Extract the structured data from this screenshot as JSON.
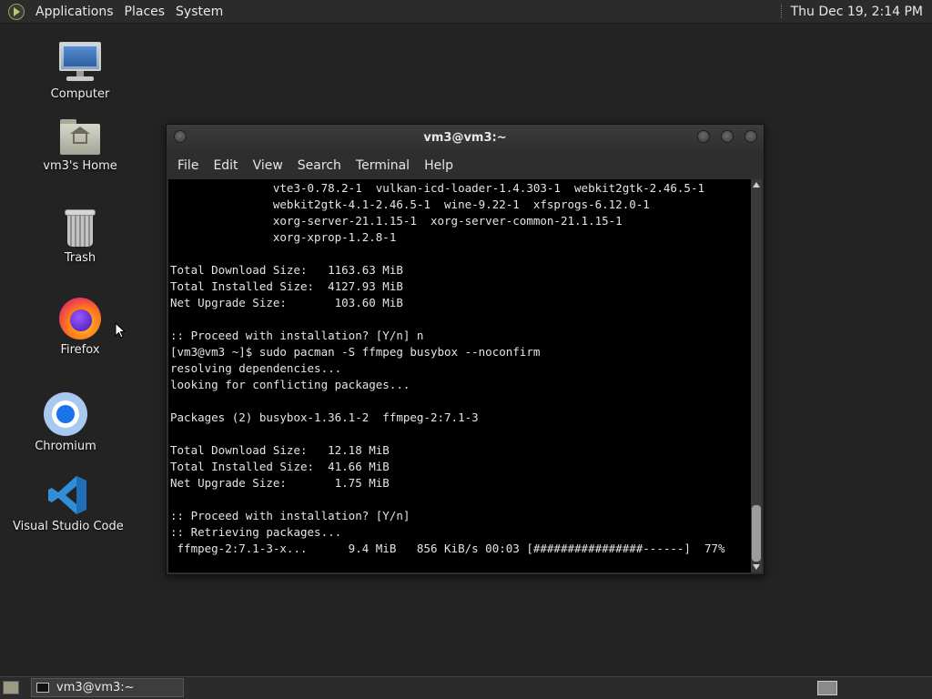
{
  "top_panel": {
    "menus": [
      "Applications",
      "Places",
      "System"
    ],
    "clock": "Thu Dec 19,  2:14 PM"
  },
  "desktop_icons": [
    {
      "label": "Computer",
      "icon": "computer-icon"
    },
    {
      "label": "vm3's Home",
      "icon": "home-folder-icon"
    },
    {
      "label": "Trash",
      "icon": "trash-icon"
    },
    {
      "label": "Firefox",
      "icon": "firefox-icon"
    },
    {
      "label": "Chromium",
      "icon": "chromium-icon"
    },
    {
      "label": "Visual Studio Code",
      "icon": "vscode-icon"
    }
  ],
  "terminal": {
    "title": "vm3@vm3:~",
    "menu": [
      "File",
      "Edit",
      "View",
      "Search",
      "Terminal",
      "Help"
    ],
    "lines": [
      "               vte3-0.78.2-1  vulkan-icd-loader-1.4.303-1  webkit2gtk-2.46.5-1",
      "               webkit2gtk-4.1-2.46.5-1  wine-9.22-1  xfsprogs-6.12.0-1",
      "               xorg-server-21.1.15-1  xorg-server-common-21.1.15-1",
      "               xorg-xprop-1.2.8-1",
      "",
      "Total Download Size:   1163.63 MiB",
      "Total Installed Size:  4127.93 MiB",
      "Net Upgrade Size:       103.60 MiB",
      "",
      ":: Proceed with installation? [Y/n] n",
      "[vm3@vm3 ~]$ sudo pacman -S ffmpeg busybox --noconfirm",
      "resolving dependencies...",
      "looking for conflicting packages...",
      "",
      "Packages (2) busybox-1.36.1-2  ffmpeg-2:7.1-3",
      "",
      "Total Download Size:   12.18 MiB",
      "Total Installed Size:  41.66 MiB",
      "Net Upgrade Size:       1.75 MiB",
      "",
      ":: Proceed with installation? [Y/n]",
      ":: Retrieving packages...",
      " ffmpeg-2:7.1-3-x...      9.4 MiB   856 KiB/s 00:03 [################------]  77%"
    ]
  },
  "taskbar": {
    "window_button": "vm3@vm3:~"
  }
}
